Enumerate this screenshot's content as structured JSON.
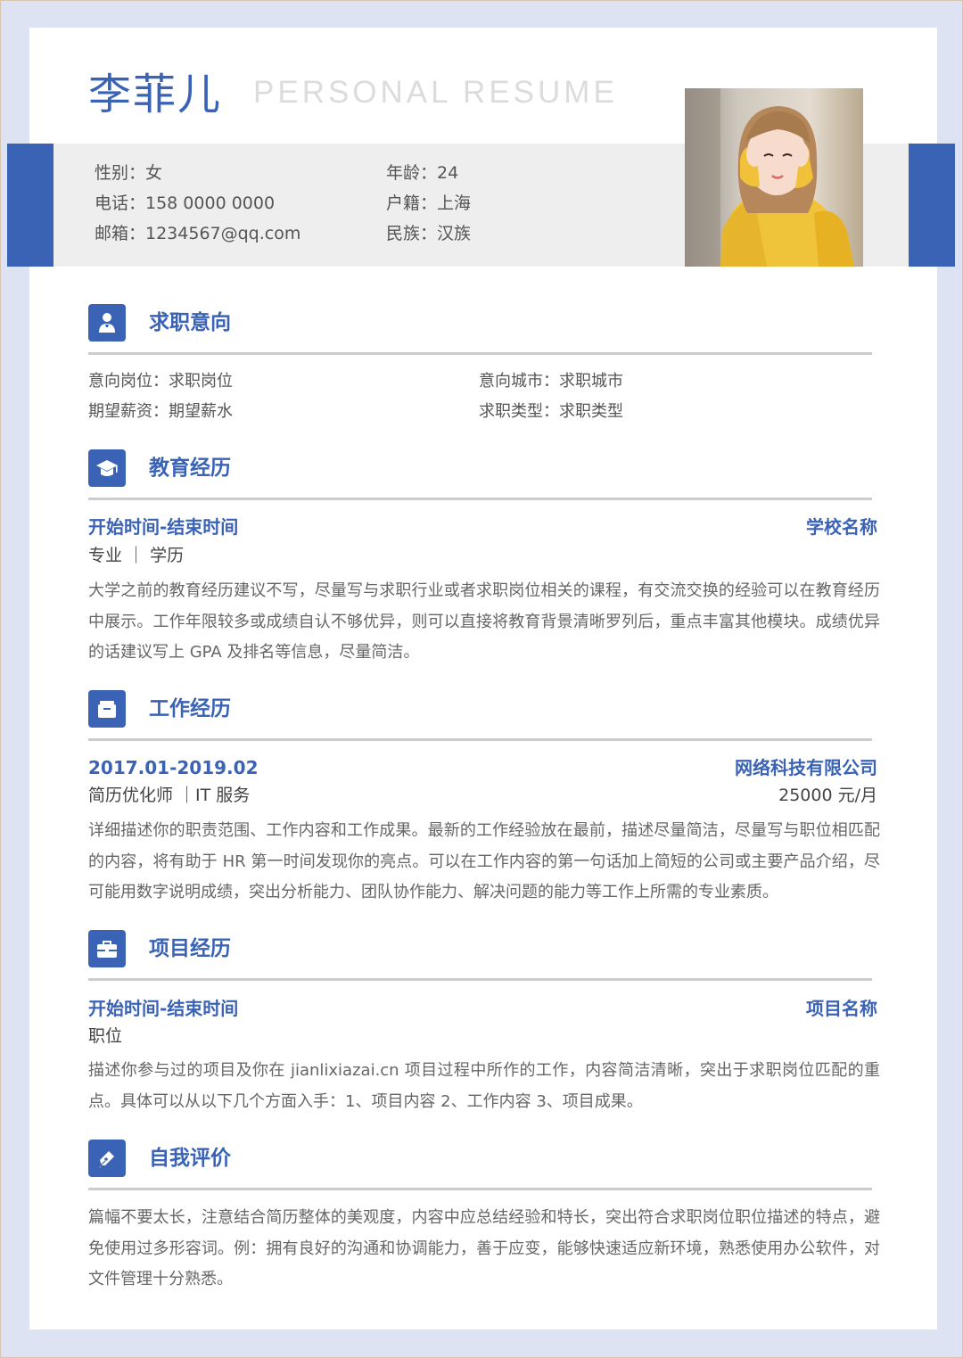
{
  "header": {
    "name": "李菲儿",
    "title": "PERSONAL RESUME"
  },
  "info": {
    "gender": "性别：女",
    "phone": "电话：158 0000 0000",
    "email": "邮箱：1234567@qq.com",
    "age": "年龄：24",
    "hometown": "户籍：上海",
    "ethnicity": "民族：汉族"
  },
  "sections": {
    "intent": {
      "title": "求职意向",
      "position": "意向岗位：求职岗位",
      "salary": "期望薪资：期望薪水",
      "city": "意向城市：求职城市",
      "type": "求职类型：求职类型"
    },
    "education": {
      "title": "教育经历",
      "period": "开始时间-结束时间",
      "school": "学校名称",
      "major": "专业 ｜ 学历",
      "description": "大学之前的教育经历建议不写，尽量写与求职行业或者求职岗位相关的课程，有交流交换的经验可以在教育经历中展示。工作年限较多或成绩自认不够优异，则可以直接将教育背景清晰罗列后，重点丰富其他模块。成绩优异的话建议写上 GPA 及排名等信息，尽量简洁。"
    },
    "work": {
      "title": "工作经历",
      "period": "2017.01-2019.02",
      "company": "网络科技有限公司",
      "role": "简历优化师 ｜IT 服务",
      "salary": "25000 元/月",
      "description": "详细描述你的职责范围、工作内容和工作成果。最新的工作经验放在最前，描述尽量简洁，尽量写与职位相匹配的内容，将有助于 HR 第一时间发现你的亮点。可以在工作内容的第一句话加上简短的公司或主要产品介绍，尽可能用数字说明成绩，突出分析能力、团队协作能力、解决问题的能力等工作上所需的专业素质。"
    },
    "project": {
      "title": "项目经历",
      "period": "开始时间-结束时间",
      "name": "项目名称",
      "role": "职位",
      "description": "描述你参与过的项目及你在 jianlixiazai.cn 项目过程中所作的工作，内容简洁清晰，突出于求职岗位匹配的重点。具体可以从以下几个方面入手：1、项目内容 2、工作内容 3、项目成果。"
    },
    "self": {
      "title": "自我评价",
      "description": "篇幅不要太长，注意结合简历整体的美观度，内容中应总结经验和特长，突出符合求职岗位职位描述的特点，避免使用过多形容词。例：拥有良好的沟通和协调能力，善于应变，能够快速适应新环境，熟悉使用办公软件，对文件管理十分熟悉。"
    }
  },
  "icons": {
    "intent": "user-icon",
    "education": "graduation-cap-icon",
    "work": "briefcase-icon",
    "project": "toolbox-icon",
    "self": "pen-icon"
  },
  "colors": {
    "accent": "#3b63b5",
    "band": "#eeeeee",
    "background": "#dde3f3"
  }
}
